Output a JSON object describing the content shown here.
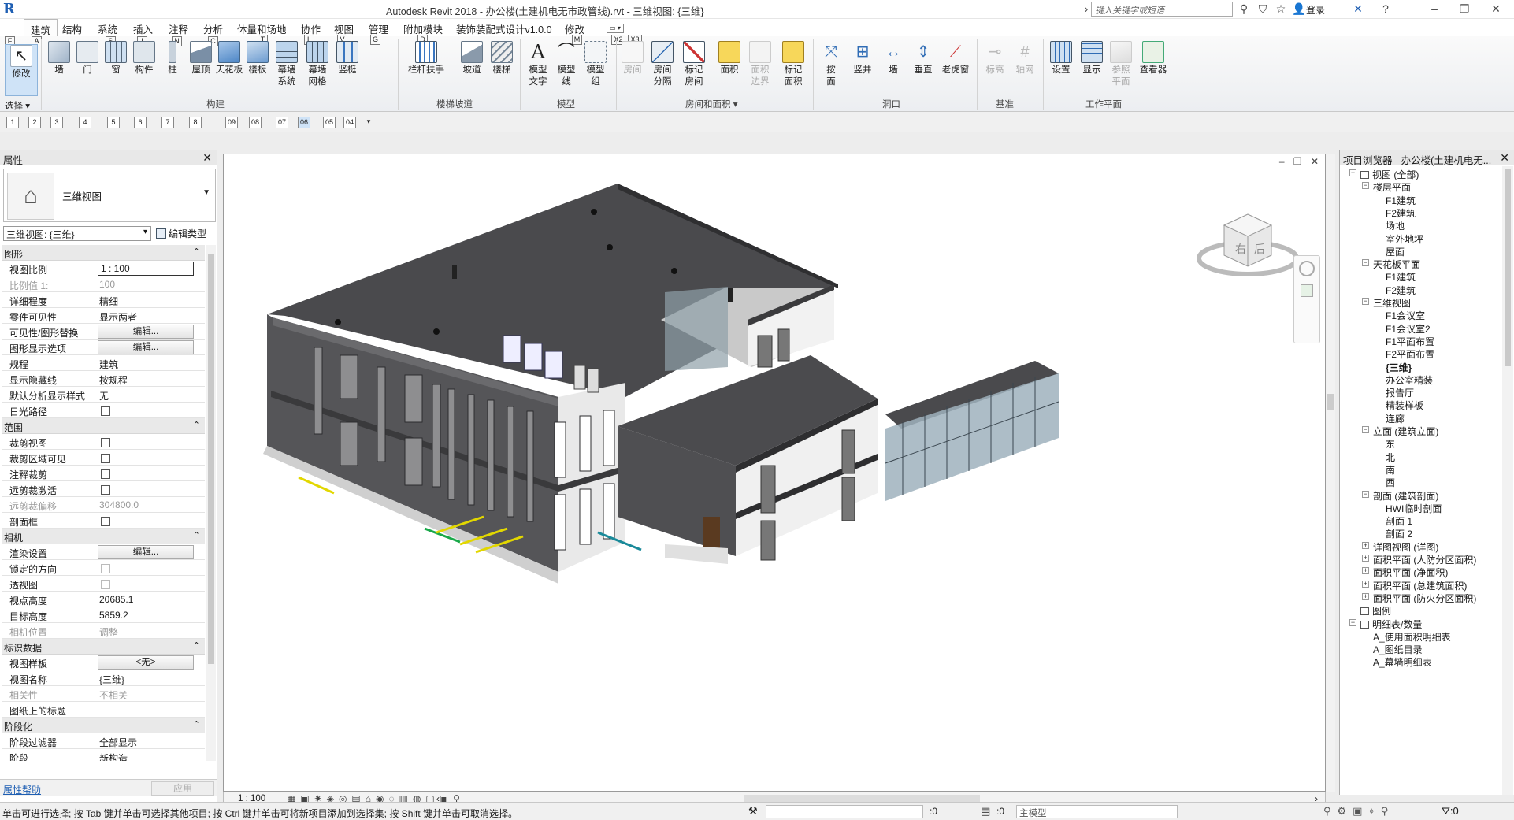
{
  "app": {
    "title": "Autodesk Revit 2018 -    办公楼(土建机电无市政管线).rvt - 三维视图: {三维}",
    "search_placeholder": "键入关键字或短语",
    "signin": "登录"
  },
  "menu": {
    "tabs": [
      "建筑",
      "结构",
      "系统",
      "插入",
      "注释",
      "分析",
      "体量和场地",
      "协作",
      "视图",
      "管理",
      "附加模块",
      "装饰装配式设计v1.0.0",
      "修改"
    ],
    "keytips": [
      "F",
      "A",
      "S",
      "I",
      "N",
      "C",
      "D",
      "T",
      "L",
      "V",
      "G",
      "D",
      "X1",
      "X3",
      "X2",
      "M"
    ]
  },
  "ribbon": {
    "modify": "修改",
    "select": "选择",
    "build": [
      "墙",
      "门",
      "窗",
      "构件",
      "柱",
      "屋顶",
      "天花板",
      "楼板",
      "幕墙\n系统",
      "幕墙\n网格",
      "竖梃"
    ],
    "build_group": "构建",
    "circ": [
      "栏杆扶手",
      "坡道",
      "楼梯"
    ],
    "circ_group": "楼梯坡道",
    "model": [
      "模型\n文字",
      "模型\n线",
      "模型\n组"
    ],
    "model_group": "模型",
    "room": [
      "房间",
      "房间\n分隔",
      "标记\n房间",
      "面积",
      "面积\n边界",
      "标记\n面积"
    ],
    "room_group": "房间和面积 ▾",
    "opening": [
      "按\n面",
      "竖井",
      "墙",
      "垂直",
      "老虎窗"
    ],
    "opening_group": "洞口",
    "datum": [
      "标高",
      "轴网"
    ],
    "datum_group": "基准",
    "wp": [
      "设置",
      "显示",
      "参照\n平面",
      "查看器"
    ],
    "wp_group": "工作平面"
  },
  "qa_toolbar": [
    "1",
    "2",
    "3",
    "4",
    "5",
    "6",
    "7",
    "8",
    "09",
    "08",
    "07",
    "06",
    "05",
    "04"
  ],
  "props": {
    "title": "属性",
    "type_name": "三维视图",
    "view_selector": "三维视图: {三维}",
    "edit_type": "编辑类型",
    "sections": [
      {
        "name": "图形",
        "rows": [
          [
            "视图比例",
            "1 : 100",
            "input"
          ],
          [
            "比例值 1:",
            "100",
            "dis"
          ],
          [
            "详细程度",
            "精细",
            ""
          ],
          [
            "零件可见性",
            "显示两者",
            ""
          ],
          [
            "可见性/图形替换",
            "编辑...",
            "btn"
          ],
          [
            "图形显示选项",
            "编辑...",
            "btn"
          ],
          [
            "规程",
            "建筑",
            ""
          ],
          [
            "显示隐藏线",
            "按规程",
            ""
          ],
          [
            "默认分析显示样式",
            "无",
            ""
          ],
          [
            "日光路径",
            "",
            "cb"
          ]
        ]
      },
      {
        "name": "范围",
        "rows": [
          [
            "裁剪视图",
            "",
            "cb"
          ],
          [
            "裁剪区域可见",
            "",
            "cb"
          ],
          [
            "注释裁剪",
            "",
            "cb"
          ],
          [
            "远剪裁激活",
            "",
            "cb"
          ],
          [
            "远剪裁偏移",
            "304800.0",
            "dis"
          ],
          [
            "剖面框",
            "",
            "cb"
          ]
        ]
      },
      {
        "name": "相机",
        "rows": [
          [
            "渲染设置",
            "编辑...",
            "btn"
          ],
          [
            "锁定的方向",
            "",
            "cbdis"
          ],
          [
            "透视图",
            "",
            "cbdis"
          ],
          [
            "视点高度",
            "20685.1",
            ""
          ],
          [
            "目标高度",
            "5859.2",
            ""
          ],
          [
            "相机位置",
            "调整",
            "dis"
          ]
        ]
      },
      {
        "name": "标识数据",
        "rows": [
          [
            "视图样板",
            "<无>",
            "btn"
          ],
          [
            "视图名称",
            "{三维}",
            ""
          ],
          [
            "相关性",
            "不相关",
            "dis"
          ],
          [
            "图纸上的标题",
            "",
            ""
          ]
        ]
      },
      {
        "name": "阶段化",
        "rows": [
          [
            "阶段过滤器",
            "全部显示",
            ""
          ],
          [
            "阶段",
            "新构造",
            ""
          ]
        ]
      }
    ],
    "help": "属性帮助",
    "apply": "应用"
  },
  "browser": {
    "title": "项目浏览器 - 办公楼(土建机电无...",
    "nodes": [
      [
        "视图 (全部)",
        0,
        "-"
      ],
      [
        "楼层平面",
        1,
        "-"
      ],
      [
        "F1建筑",
        2,
        ""
      ],
      [
        "F2建筑",
        2,
        ""
      ],
      [
        "场地",
        2,
        ""
      ],
      [
        "室外地坪",
        2,
        ""
      ],
      [
        "屋面",
        2,
        ""
      ],
      [
        "天花板平面",
        1,
        "-"
      ],
      [
        "F1建筑",
        2,
        ""
      ],
      [
        "F2建筑",
        2,
        ""
      ],
      [
        "三维视图",
        1,
        "-"
      ],
      [
        "F1会议室",
        2,
        ""
      ],
      [
        "F1会议室2",
        2,
        ""
      ],
      [
        "F1平面布置",
        2,
        ""
      ],
      [
        "F2平面布置",
        2,
        ""
      ],
      [
        "{三维}",
        2,
        "b"
      ],
      [
        "办公室精装",
        2,
        ""
      ],
      [
        "报告厅",
        2,
        ""
      ],
      [
        "精装样板",
        2,
        ""
      ],
      [
        "连廊",
        2,
        ""
      ],
      [
        "立面 (建筑立面)",
        1,
        "-"
      ],
      [
        "东",
        2,
        ""
      ],
      [
        "北",
        2,
        ""
      ],
      [
        "南",
        2,
        ""
      ],
      [
        "西",
        2,
        ""
      ],
      [
        "剖面 (建筑剖面)",
        1,
        "-"
      ],
      [
        "HWI临时剖面",
        2,
        ""
      ],
      [
        "剖面 1",
        2,
        ""
      ],
      [
        "剖面 2",
        2,
        ""
      ],
      [
        "详图视图 (详图)",
        1,
        "+"
      ],
      [
        "面积平面 (人防分区面积)",
        1,
        "+"
      ],
      [
        "面积平面 (净面积)",
        1,
        "+"
      ],
      [
        "面积平面 (总建筑面积)",
        1,
        "+"
      ],
      [
        "面积平面 (防火分区面积)",
        1,
        "+"
      ],
      [
        "图例",
        0,
        ""
      ],
      [
        "明细表/数量",
        0,
        "-"
      ],
      [
        "A_使用面积明细表",
        1,
        ""
      ],
      [
        "A_图纸目录",
        1,
        ""
      ],
      [
        "A_幕墙明细表",
        1,
        ""
      ]
    ]
  },
  "viewcube": {
    "right": "右",
    "back": "后"
  },
  "viewbar": {
    "scale": "1 : 100"
  },
  "status": {
    "text": "单击可进行选择; 按 Tab 键并单击可选择其他项目; 按 Ctrl 键并单击可将新项目添加到选择集; 按 Shift 键并单击可取消选择。",
    "model": "主模型",
    "zero1": ":0",
    "zero2": ":0"
  }
}
